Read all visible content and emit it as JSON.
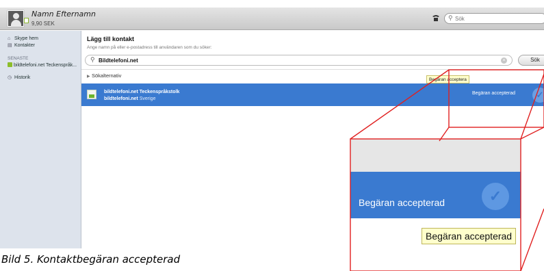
{
  "topbar": {
    "user_name": "Namn Efternamn",
    "credit": "9,90 SEK",
    "search_placeholder": "Sök"
  },
  "sidebar": {
    "items": [
      {
        "label": "Skype hem",
        "icon": "home-icon"
      },
      {
        "label": "Kontakter",
        "icon": "contacts-icon"
      }
    ],
    "recent_heading": "SENASTE",
    "recent_item": "bildtelefoni.net Teckenspråk...",
    "history_label": "Historik"
  },
  "main": {
    "title": "Lägg till kontakt",
    "subtitle": "Ange namn på eller e-postadress till användaren som du söker:",
    "search_value": "Bildtelefoni.net",
    "search_button": "Sök",
    "options_label": "Sökalternativ",
    "result": {
      "name": "bildtelefoni.net Teckenspråkstolk",
      "username": "bildtelefoni.net",
      "country": "Sverige",
      "status": "Begäran accepterad"
    },
    "tooltip": "Begäran acceptera"
  },
  "inset": {
    "status": "Begäran accepterad",
    "tooltip": "Begäran accepterad"
  },
  "caption": "Bild 5. Kontaktbegäran accepterad",
  "colors": {
    "accent_blue": "#3a7ad0",
    "callout_red": "#e02020",
    "tooltip_yellow": "#ffffcc",
    "online_green": "#8cbd2a"
  }
}
